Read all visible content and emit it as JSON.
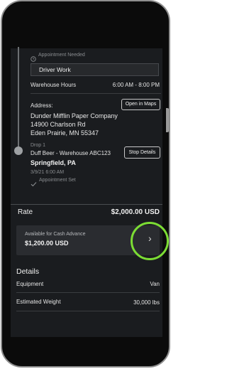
{
  "appointment_needed": "Appointment Needed",
  "driver_work": "Driver Work",
  "warehouse_hours_label": "Warehouse Hours",
  "warehouse_hours_value": "6:00 AM - 8:00 PM",
  "address_label": "Address:",
  "open_in_maps": "Open in Maps",
  "address_lines": [
    "Dunder Mifflin Paper Company",
    "14900 Charlson Rd",
    "Eden Prairie, MN 55347"
  ],
  "drop": {
    "label": "Drop 1",
    "name": "Duff Beer - Warehouse ABC123",
    "city": "Springfield, PA",
    "datetime": "3/9/21 6:00 AM",
    "status": "Appointment Set"
  },
  "stop_details": "Stop Details",
  "rate_label": "Rate",
  "rate_value": "$2,000.00 USD",
  "cash_advance": {
    "label": "Available for Cash Advance",
    "amount": "$1,200.00 USD",
    "chevron": "›"
  },
  "details_title": "Details",
  "details": [
    {
      "label": "Equipment",
      "value": "Van"
    },
    {
      "label": "Estimated Weight",
      "value": "30,000 lbs"
    }
  ],
  "icons": {
    "clock": "clock-icon",
    "check": "check-icon"
  },
  "colors": {
    "highlight": "#7cdd34",
    "screen_bg": "#1a1c1f"
  }
}
